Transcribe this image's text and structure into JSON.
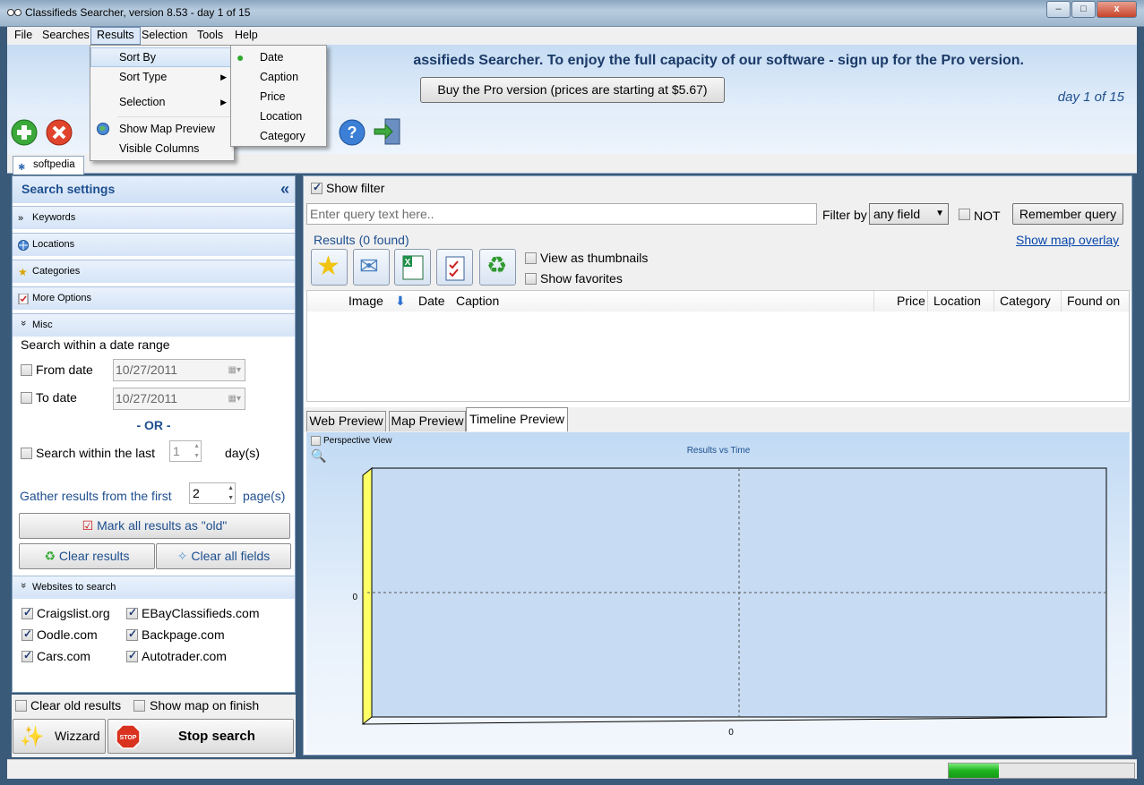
{
  "window": {
    "title": "Classifieds Searcher, version 8.53 - day 1 of 15",
    "min_label": "–",
    "max_label": "□",
    "close_label": "x"
  },
  "menubar": {
    "items": [
      "File",
      "Searches",
      "Results",
      "Selection",
      "Tools",
      "Help"
    ]
  },
  "results_menu": {
    "items": [
      "Sort By",
      "Sort Type",
      "Selection",
      "Show Map Preview",
      "Visible Columns"
    ]
  },
  "sort_by_menu": {
    "items": [
      "Date",
      "Caption",
      "Price",
      "Location",
      "Category"
    ]
  },
  "banner": {
    "message": "assifieds Searcher. To enjoy the full capacity of our software - sign up for the Pro version.",
    "pro_button": "Buy the Pro version (prices are starting at $5.67)",
    "day_info": "day 1 of 15"
  },
  "tab": {
    "label": "softpedia"
  },
  "left": {
    "header": "Search settings",
    "sections": [
      "Keywords",
      "Locations",
      "Categories",
      "More Options",
      "Misc"
    ],
    "date_range_title": "Search within a date range",
    "from_label": "From date",
    "from_value": "10/27/2011",
    "to_label": "To date",
    "to_value": "10/27/2011",
    "or_label": "- OR -",
    "within_last_label": "Search within the last",
    "within_last_value": "1",
    "days_label": "day(s)",
    "gather_label": "Gather results from the first",
    "gather_value": "2",
    "pages_label": "page(s)",
    "mark_old": "Mark all results as \"old\"",
    "clear_results": "Clear results",
    "clear_fields": "Clear all fields",
    "websites_header": "Websites to search",
    "sites_col1": [
      "Craigslist.org",
      "Oodle.com",
      "Cars.com"
    ],
    "sites_col2": [
      "EBayClassifieds.com",
      "Backpage.com",
      "Autotrader.com"
    ],
    "clear_old": "Clear old results",
    "show_map": "Show map on finish",
    "wizard": "Wizzard",
    "stop": "Stop search"
  },
  "right": {
    "show_filter": "Show filter",
    "query_placeholder": "Enter query text here..",
    "filter_by": "Filter by",
    "filter_value": "any field",
    "not_label": "NOT",
    "remember": "Remember query",
    "results_label": "Results (0 found)",
    "show_map_overlay": "Show map overlay",
    "view_thumbs": "View as thumbnails",
    "show_favs": "Show favorites",
    "columns": [
      "Image",
      "Date",
      "Caption",
      "Price",
      "Location",
      "Category",
      "Found on"
    ],
    "preview_tabs": [
      "Web Preview",
      "Map Preview",
      "Timeline Preview"
    ],
    "perspective": "Perspective View"
  },
  "chart_data": {
    "type": "bar",
    "title": "Results vs Time",
    "categories": [],
    "values": [],
    "y_tick": "0",
    "x_tick": "0"
  },
  "status": {
    "progress": 0.27
  },
  "colors": {
    "accent": "#1e4f8f",
    "banner_text": "#1b3a68",
    "progress": "#1eb31e"
  }
}
